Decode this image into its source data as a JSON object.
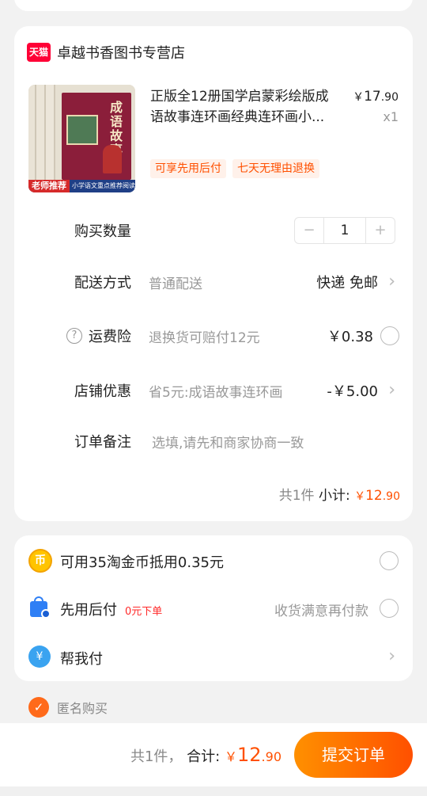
{
  "shop": {
    "badge": "天猫",
    "name": "卓越书香图书专营店"
  },
  "product": {
    "thumb_title": "成语故事",
    "thumb_strip_red": "老师推荐",
    "thumb_strip_blue": "小学语文重点推荐阅读",
    "title": "正版全12册国学启蒙彩绘版成语故事连环画经典连环画小...",
    "price_symbol": "￥",
    "price_int": "17",
    "price_dec": ".90",
    "qty_label": "x1",
    "tags": [
      "可享先用后付",
      "七天无理由退换"
    ]
  },
  "order_rows": {
    "quantity_label": "购买数量",
    "quantity_minus": "−",
    "quantity_value": "1",
    "quantity_plus": "+",
    "delivery_label": "配送方式",
    "delivery_hint": "普通配送",
    "delivery_value": "快递 免邮",
    "insurance_icon": "?",
    "insurance_label": "运费险",
    "insurance_hint": "退换货可赔付12元",
    "insurance_value": "￥0.38",
    "discount_label": "店铺优惠",
    "discount_hint": "省5元:成语故事连环画",
    "discount_value": "-￥5.00",
    "remark_label": "订单备注",
    "remark_placeholder": "选填,请先和商家协商一致",
    "chevron": "›"
  },
  "subtotal": {
    "count": "共1件",
    "label": "小计:",
    "symbol": "￥",
    "int": "12",
    "dec": ".90"
  },
  "payment": {
    "coin_icon": "币",
    "coin_text": "可用35淘金币抵用0.35元",
    "later_text": "先用后付",
    "later_badge": "0元下单",
    "later_note": "收货满意再付款",
    "help_icon": "¥",
    "help_text": "帮我付",
    "chevron": "›"
  },
  "anonymous": {
    "check": "✓",
    "label": "匿名购买"
  },
  "bottom_bar": {
    "count": "共1件，",
    "label": "合计:",
    "symbol": "￥",
    "int": "12",
    "dec": ".90",
    "submit": "提交订单"
  },
  "colors": {
    "accent": "#ff5000",
    "tmall": "#ff0036"
  }
}
